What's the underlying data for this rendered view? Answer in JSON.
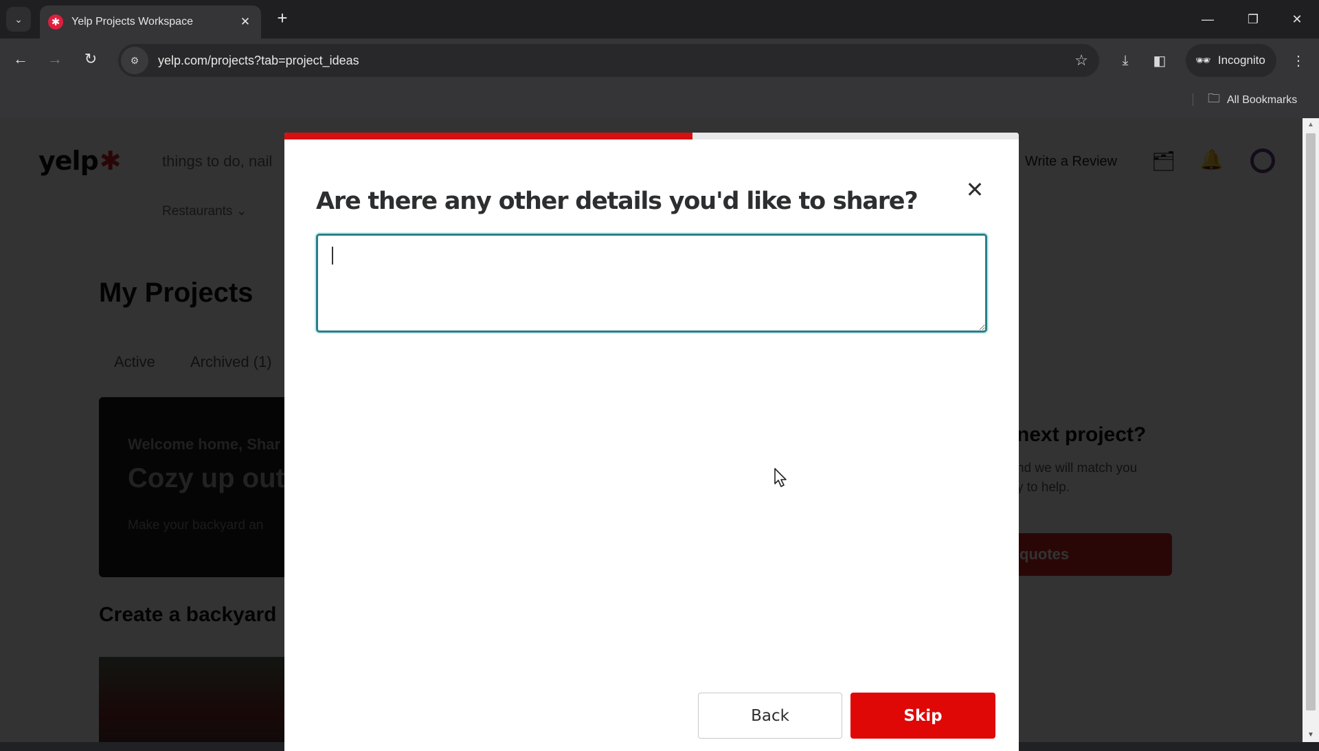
{
  "browser": {
    "tab_title": "Yelp Projects Workspace",
    "tab_favicon": "yelp-burst-icon",
    "new_tab": "+",
    "url": "yelp.com/projects?tab=project_ideas",
    "incognito_label": "Incognito",
    "bookmarks_label": "All Bookmarks",
    "icons": {
      "tab_search": "⌄",
      "tab_close": "✕",
      "minimize": "—",
      "restore": "❐",
      "close": "✕",
      "back": "←",
      "forward": "→",
      "reload": "↻",
      "site_info": "⚙",
      "bookmark_star": "☆",
      "download": "⤓",
      "side_panel": "◧",
      "incognito": "🕶",
      "menu": "⋮",
      "folder": "🗀"
    }
  },
  "page": {
    "logo_text": "yelp",
    "logo_burst": "✱",
    "search_placeholder": "things to do, nail",
    "category_menu": "Restaurants ⌄",
    "write_review": "Write a Review",
    "title": "My Projects",
    "tabs": [
      {
        "label": "Active"
      },
      {
        "label": "Archived (1)"
      }
    ],
    "hero": {
      "kicker": "Welcome home, Shar",
      "headline": "Cozy up out",
      "subtext": "Make your backyard an"
    },
    "next_project": {
      "heading": "next project?",
      "text_line1": "nd we will match you",
      "text_line2": "y to help.",
      "button": "quotes"
    },
    "section_title": "Create a backyard"
  },
  "modal": {
    "progress_percent": 55.6,
    "title": "Are there any other details you'd like to share?",
    "close_icon": "✕",
    "input_value": "",
    "input_placeholder": "",
    "back_label": "Back",
    "skip_label": "Skip"
  },
  "colors": {
    "brand_red": "#d70f0f",
    "button_red": "#e00707",
    "input_focus": "#2a7f86"
  }
}
